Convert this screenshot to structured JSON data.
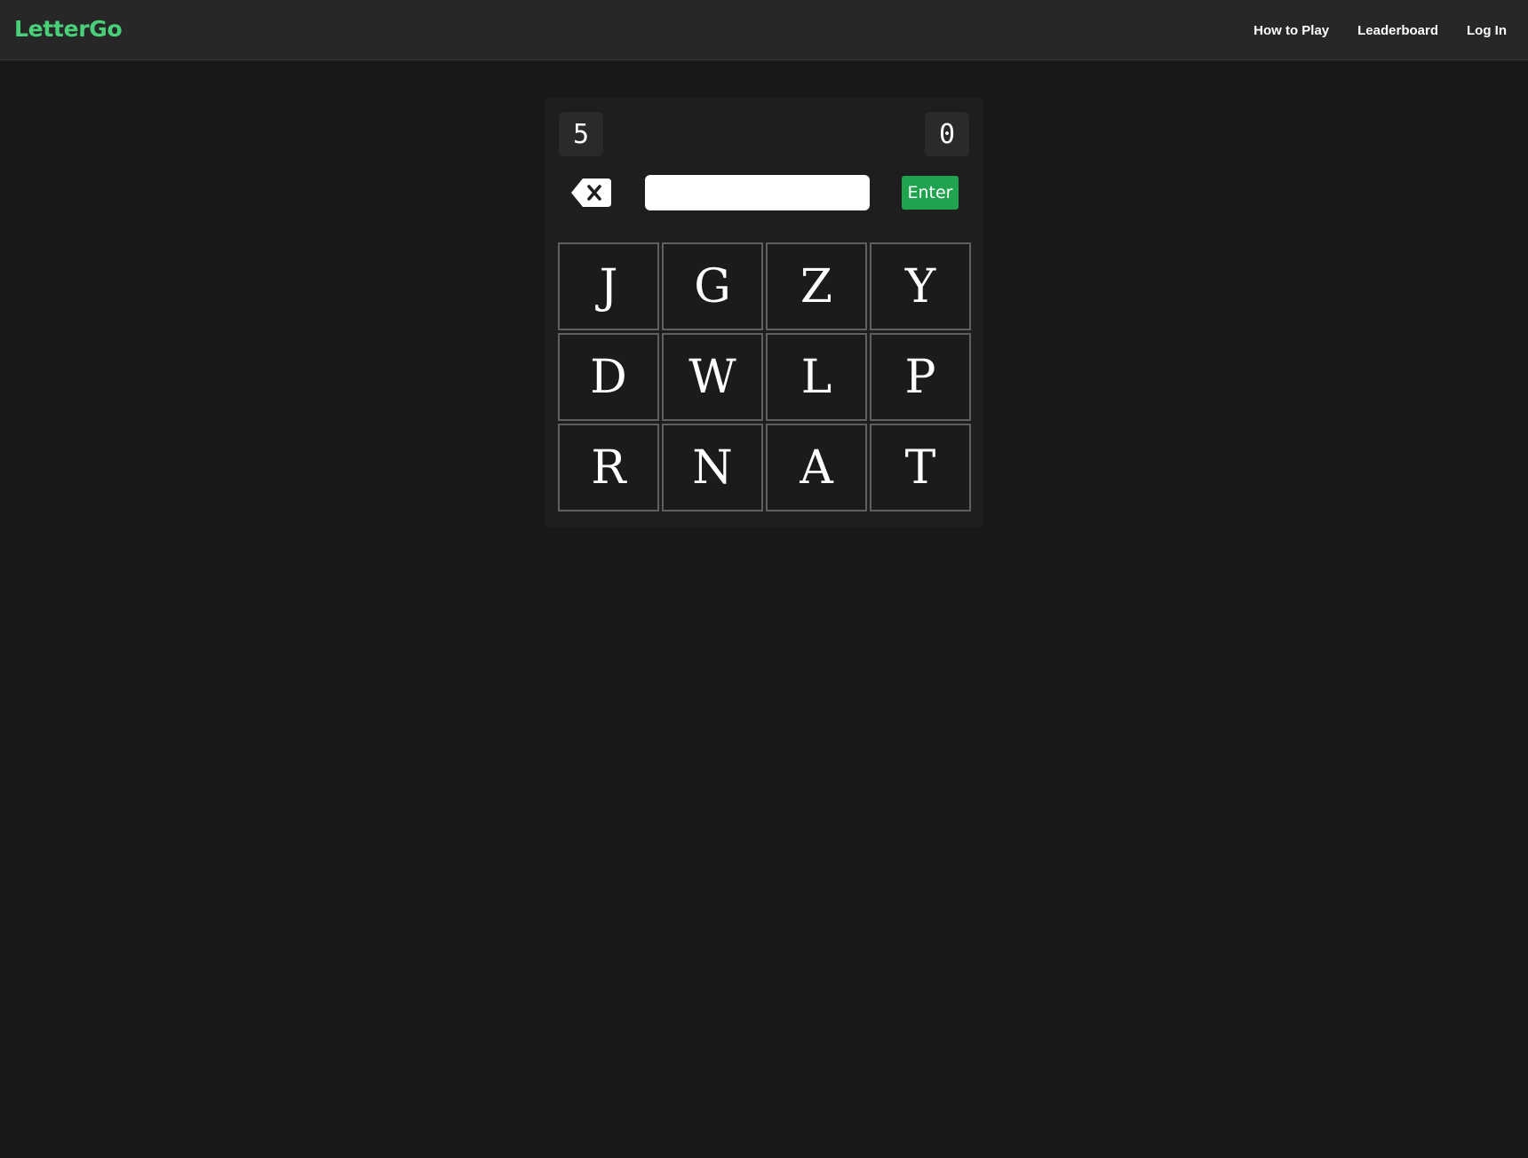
{
  "header": {
    "logo": "LetterGo",
    "nav": [
      {
        "label": "How to Play"
      },
      {
        "label": "Leaderboard"
      },
      {
        "label": "Log In"
      }
    ]
  },
  "game": {
    "left_counter": "5",
    "right_counter": "0",
    "input_value": "",
    "enter_label": "Enter",
    "tiles": [
      "J",
      "G",
      "Z",
      "Y",
      "D",
      "W",
      "L",
      "P",
      "R",
      "N",
      "A",
      "T"
    ]
  },
  "colors": {
    "background": "#181818",
    "header": "#272727",
    "logo": "#4ad07a",
    "enter_button": "#1fa34f"
  },
  "icons": {
    "backspace": "backspace-icon"
  }
}
